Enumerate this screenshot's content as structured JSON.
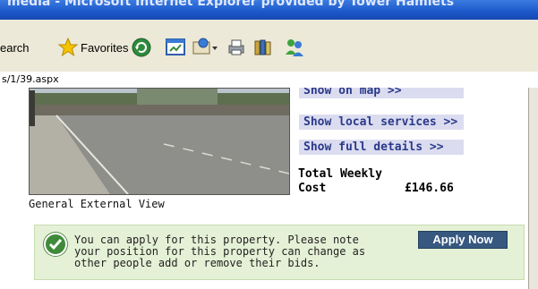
{
  "window": {
    "title": "media - Microsoft Internet Explorer provided by Tower Hamlets"
  },
  "toolbar": {
    "search_label": "earch",
    "favorites_label": "Favorites"
  },
  "address": {
    "url": "s/1/39.aspx"
  },
  "property": {
    "photo_caption": "General External View",
    "links": {
      "map": "Show on map >>",
      "local_services": "Show local services >>",
      "full_details": "Show full details >>"
    },
    "cost_label_line1": "Total Weekly",
    "cost_label_line2": "Cost",
    "cost_value": "£146.66"
  },
  "notice": {
    "text": "You can apply for this property. Please note your position for this property can change as other people add or remove their bids.",
    "apply_button": "Apply Now"
  },
  "colors": {
    "link_bg": "#dcdcf0",
    "link_text": "#2a3a8a",
    "notice_bg": "#e5f1d6",
    "button_bg": "#37587f"
  }
}
